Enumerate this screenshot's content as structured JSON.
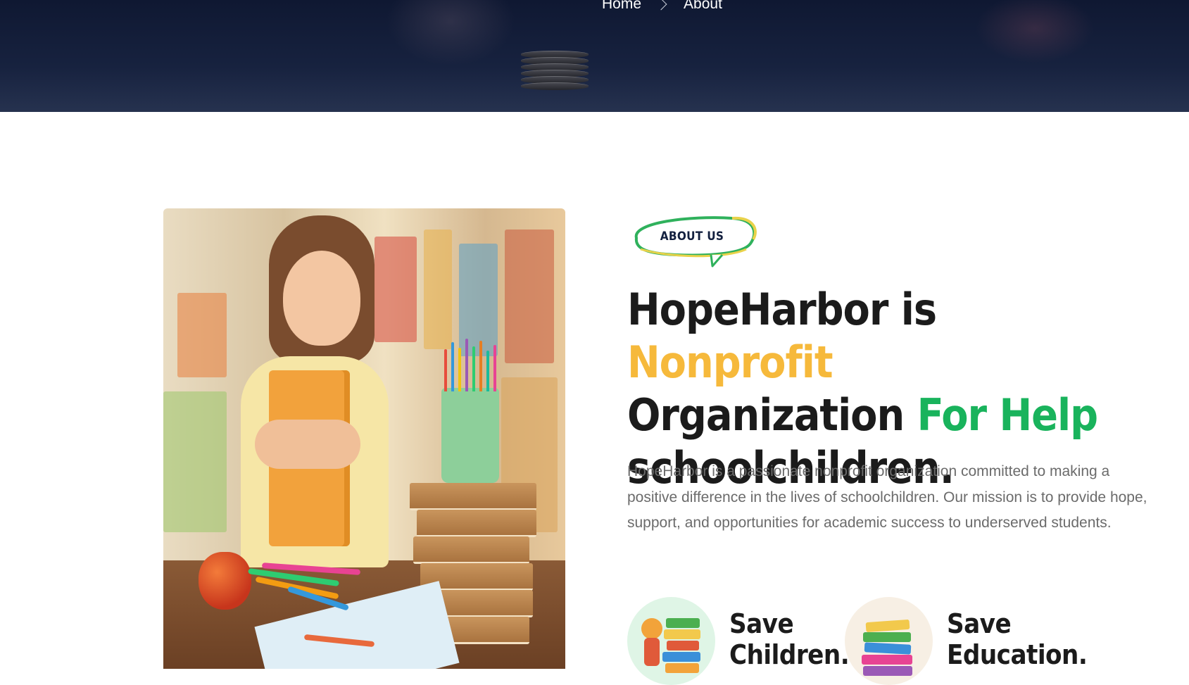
{
  "breadcrumb": {
    "home": "Home",
    "current": "About"
  },
  "about": {
    "badge": "ABOUT US",
    "headline": {
      "part1": "HopeHarbor is ",
      "highlight1": "Nonprofit",
      "part2": "Organization ",
      "highlight2": "For Help",
      "part3": "schoolchildren."
    },
    "description": "HopeHarbor is a passionate nonprofit organization committed to making a positive difference in the lives of schoolchildren. Our mission is to provide hope, support, and opportunities for academic success to underserved students.",
    "features": [
      {
        "title": "Save Children.",
        "icon": "child-books-icon"
      },
      {
        "title": "Save Education.",
        "icon": "books-stack-icon"
      }
    ]
  },
  "colors": {
    "navy": "#13203f",
    "accent_yellow": "#f6b93b",
    "accent_green": "#19b35c",
    "text_dark": "#1b1b1b",
    "text_body": "#6b6b6b"
  }
}
